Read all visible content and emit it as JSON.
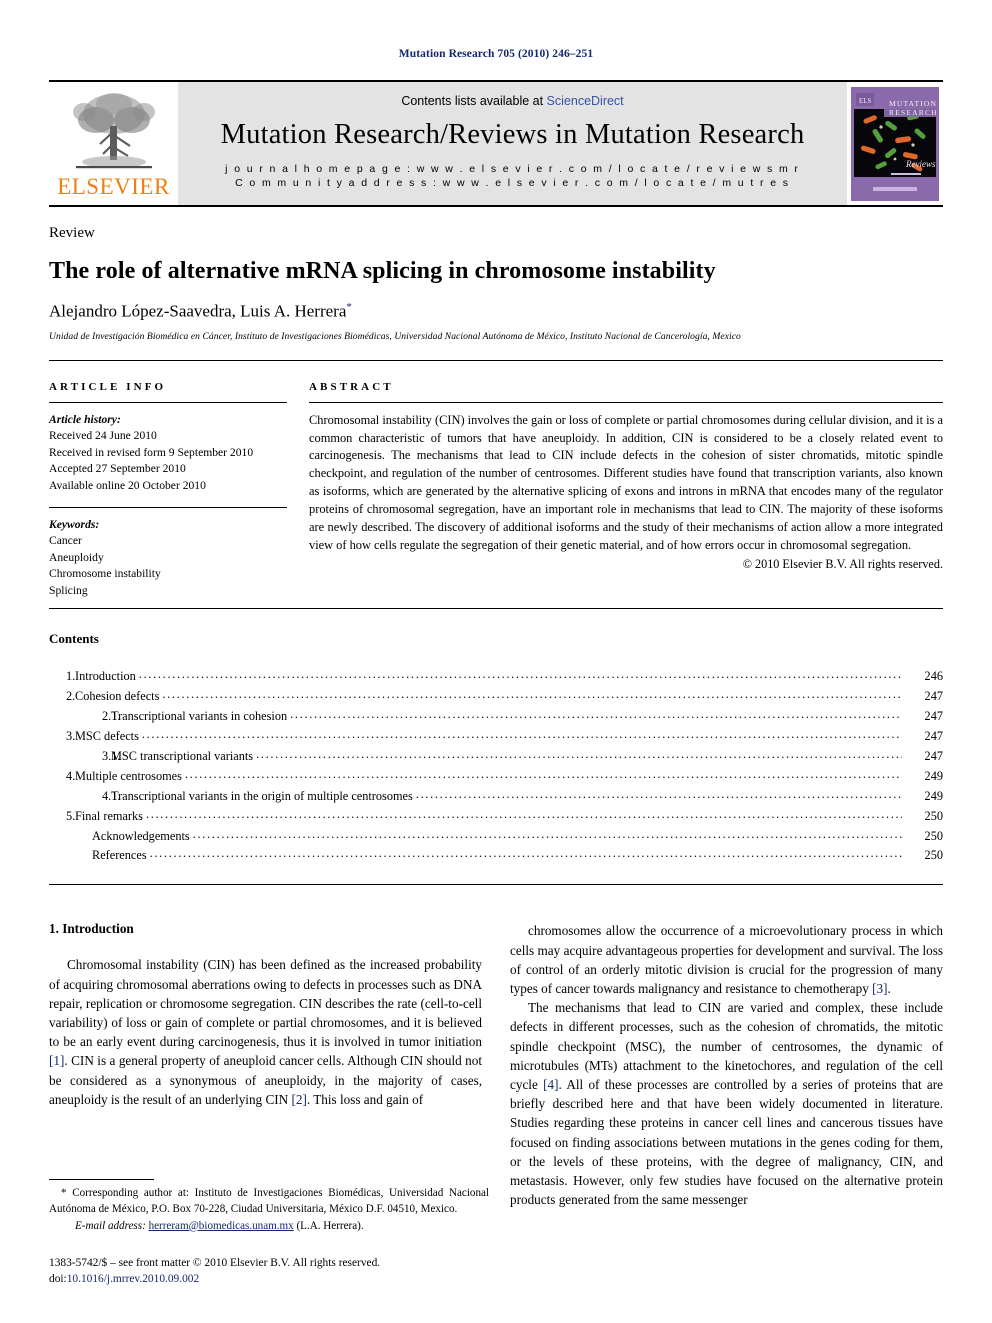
{
  "running_head": "Mutation Research 705 (2010) 246–251",
  "masthead": {
    "publisher_name": "ELSEVIER",
    "contents_prefix": "Contents lists available at ",
    "contents_link": "ScienceDirect",
    "journal_title": "Mutation Research/Reviews in Mutation Research",
    "homepage_line": "j o u r n a l   h o m e p a g e :   w w w . e l s e v i e r . c o m / l o c a t e / r e v i e w s m r",
    "community_line": "C o m m u n i t y   a d d r e s s :   w w w . e l s e v i e r . c o m / l o c a t e / m u t r e s",
    "cover": {
      "title_line_1": "MUTATION",
      "title_line_2": "RESEARCH",
      "subtitle": "Reviews"
    }
  },
  "article": {
    "type": "Review",
    "title": "The role of alternative mRNA splicing in chromosome instability",
    "authors": "Alejandro López-Saavedra, Luis A. Herrera",
    "corresponding_marker": "*",
    "affiliation": "Unidad de Investigación Biomédica en Cáncer, Instituto de Investigaciones Biomédicas, Universidad Nacional Autónoma de México, Instituto Nacional de Cancerología, Mexico"
  },
  "article_info": {
    "label": "ARTICLE INFO",
    "history_label": "Article history:",
    "history": [
      "Received 24 June 2010",
      "Received in revised form 9 September 2010",
      "Accepted 27 September 2010",
      "Available online 20 October 2010"
    ],
    "keywords_label": "Keywords:",
    "keywords": [
      "Cancer",
      "Aneuploidy",
      "Chromosome instability",
      "Splicing"
    ]
  },
  "abstract": {
    "label": "ABSTRACT",
    "text": "Chromosomal instability (CIN) involves the gain or loss of complete or partial chromosomes during cellular division, and it is a common characteristic of tumors that have aneuploidy. In addition, CIN is considered to be a closely related event to carcinogenesis. The mechanisms that lead to CIN include defects in the cohesion of sister chromatids, mitotic spindle checkpoint, and regulation of the number of centrosomes. Different studies have found that transcription variants, also known as isoforms, which are generated by the alternative splicing of exons and introns in mRNA that encodes many of the regulator proteins of chromosomal segregation, have an important role in mechanisms that lead to CIN. The majority of these isoforms are newly described. The discovery of additional isoforms and the study of their mechanisms of action allow a more integrated view of how cells regulate the segregation of their genetic material, and of how errors occur in chromosomal segregation.",
    "copyright": "© 2010 Elsevier B.V. All rights reserved."
  },
  "contents": {
    "heading": "Contents",
    "entries": [
      {
        "num": "1.",
        "label": "Introduction",
        "page": "246",
        "level": "top"
      },
      {
        "num": "2.",
        "label": "Cohesion defects",
        "page": "247",
        "level": "top"
      },
      {
        "num": "2.1.",
        "label": "Transcriptional variants in cohesion",
        "page": "247",
        "level": "sub"
      },
      {
        "num": "3.",
        "label": "MSC defects",
        "page": "247",
        "level": "top"
      },
      {
        "num": "3.1.",
        "label": "MSC transcriptional variants",
        "page": "247",
        "level": "sub"
      },
      {
        "num": "4.",
        "label": "Multiple centrosomes",
        "page": "249",
        "level": "top"
      },
      {
        "num": "4.1.",
        "label": "Transcriptional variants in the origin of multiple centrosomes",
        "page": "249",
        "level": "sub"
      },
      {
        "num": "5.",
        "label": "Final remarks",
        "page": "250",
        "level": "top"
      },
      {
        "num": "",
        "label": "Acknowledgements",
        "page": "250",
        "level": "plain"
      },
      {
        "num": "",
        "label": "References",
        "page": "250",
        "level": "plain"
      }
    ]
  },
  "body": {
    "section_heading": "1. Introduction",
    "left_paragraphs": [
      "Chromosomal instability (CIN) has been defined as the increased probability of acquiring chromosomal aberrations owing to defects in processes such as DNA repair, replication or chromosome segregation. CIN describes the rate (cell-to-cell variability) of loss or gain of complete or partial chromosomes, and it is believed to be an early event during carcinogenesis, thus it is involved in tumor initiation [1]. CIN is a general property of aneuploid cancer cells. Although CIN should not be considered as a synonymous of aneuploidy, in the majority of cases, aneuploidy is the result of an underlying CIN [2]. This loss and gain of"
    ],
    "right_paragraphs": [
      "chromosomes allow the occurrence of a microevolutionary process in which cells may acquire advantageous properties for development and survival. The loss of control of an orderly mitotic division is crucial for the progression of many types of cancer towards malignancy and resistance to chemotherapy [3].",
      "The mechanisms that lead to CIN are varied and complex, these include defects in different processes, such as the cohesion of chromatids, the mitotic spindle checkpoint (MSC), the number of centrosomes, the dynamic of microtubules (MTs) attachment to the kinetochores, and regulation of the cell cycle [4]. All of these processes are controlled by a series of proteins that are briefly described here and that have been widely documented in literature. Studies regarding these proteins in cancer cell lines and cancerous tissues have focused on finding associations between mutations in the genes coding for them, or the levels of these proteins, with the degree of malignancy, CIN, and metastasis. However, only few studies have focused on the alternative protein products generated from the same messenger"
    ]
  },
  "footnotes": {
    "corresponding": "* Corresponding author at: Instituto de Investigaciones Biomédicas, Universidad Nacional Autónoma de México, P.O. Box 70-228, Ciudad Universitaria, México D.F. 04510, Mexico.",
    "email_label": "E-mail address:",
    "email": "herreram@biomedicas.unam.mx",
    "email_suffix": "(L.A. Herrera).",
    "issn_line": "1383-5742/$ – see front matter © 2010 Elsevier B.V. All rights reserved.",
    "doi_label": "doi:",
    "doi_value": "10.1016/j.mrrev.2010.09.002"
  },
  "colors": {
    "link_blue": "#15276b",
    "sciencedirect_blue": "#3a53a4",
    "elsevier_orange": "#f07f13",
    "masthead_grey": "#e3e3e3",
    "cover_purple": "#8a6aaa"
  }
}
